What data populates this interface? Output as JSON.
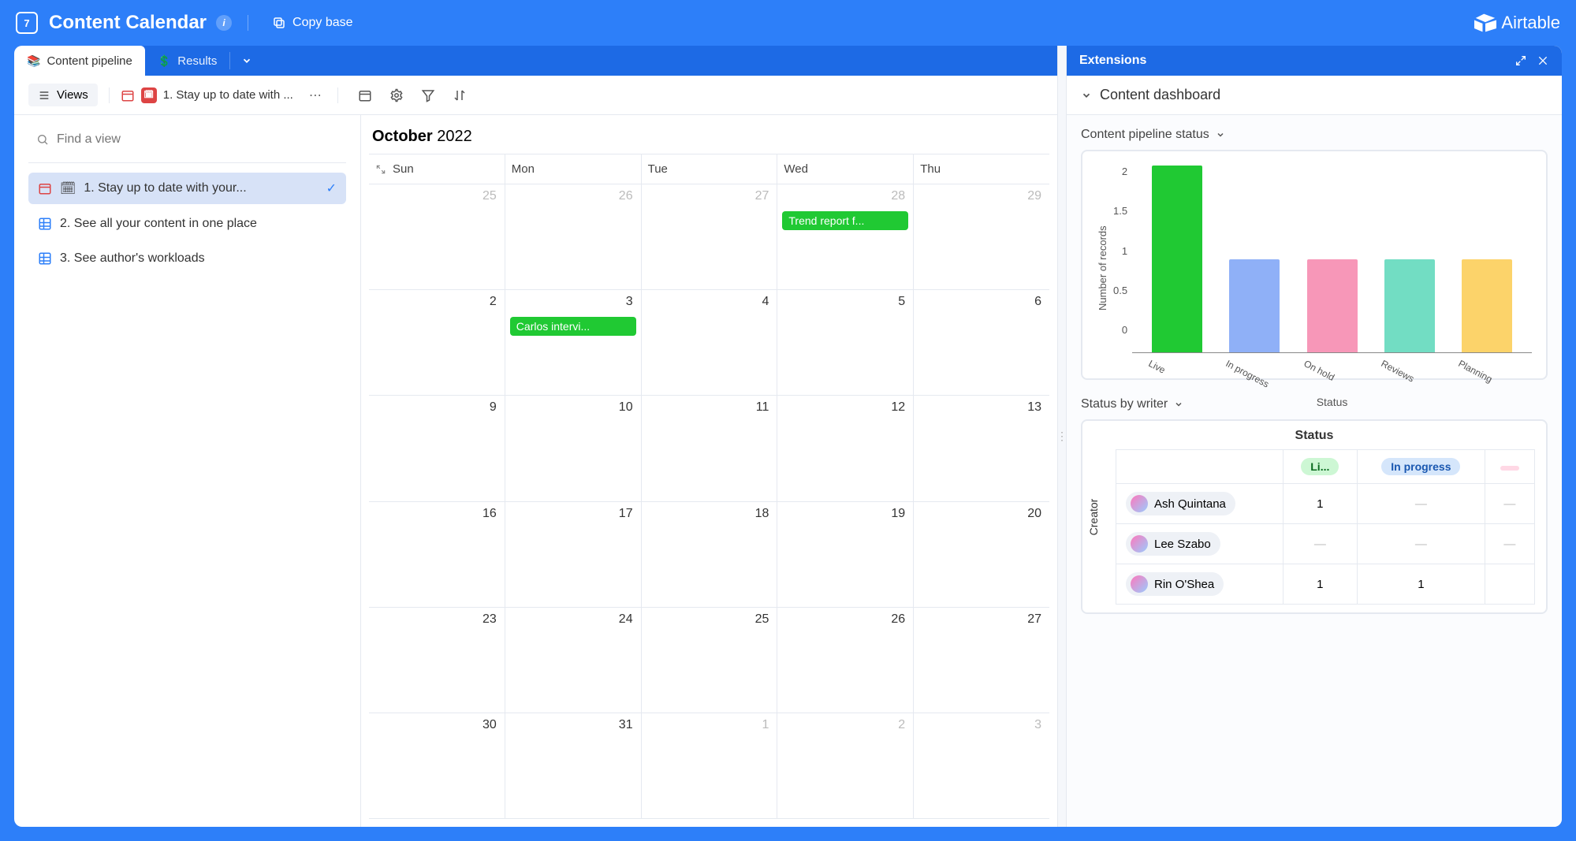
{
  "header": {
    "app_title": "Content Calendar",
    "app_day_badge": "7",
    "copy_base": "Copy base",
    "logo_text": "Airtable"
  },
  "tabs": {
    "items": [
      {
        "emoji": "📚",
        "label": "Content pipeline",
        "active": true
      },
      {
        "emoji": "💲",
        "label": "Results",
        "active": false
      }
    ]
  },
  "toolbar": {
    "views": "Views",
    "current_view_emoji": "🗓",
    "current_view": "1. Stay up to date with ..."
  },
  "sidebar": {
    "find_placeholder": "Find a view",
    "items": [
      {
        "kind": "calendar",
        "emoji": "🗓",
        "label": "1. Stay up to date with your...",
        "active": true
      },
      {
        "kind": "grid",
        "label": "2. See all your content in one place",
        "active": false
      },
      {
        "kind": "grid",
        "label": "3. See author's workloads",
        "active": false
      }
    ]
  },
  "calendar": {
    "month": "October",
    "year": "2022",
    "day_headers": [
      "Sun",
      "Mon",
      "Tue",
      "Wed",
      "Thu"
    ],
    "weeks": [
      {
        "days": [
          {
            "n": "25",
            "out": true
          },
          {
            "n": "26",
            "out": true
          },
          {
            "n": "27",
            "out": true
          },
          {
            "n": "28",
            "out": true,
            "event": "Trend report f..."
          },
          {
            "n": "29",
            "out": true
          }
        ]
      },
      {
        "days": [
          {
            "n": "2"
          },
          {
            "n": "3",
            "event": "Carlos intervi..."
          },
          {
            "n": "4"
          },
          {
            "n": "5"
          },
          {
            "n": "6"
          }
        ]
      },
      {
        "days": [
          {
            "n": "9"
          },
          {
            "n": "10"
          },
          {
            "n": "11"
          },
          {
            "n": "12"
          },
          {
            "n": "13"
          }
        ]
      },
      {
        "days": [
          {
            "n": "16"
          },
          {
            "n": "17"
          },
          {
            "n": "18"
          },
          {
            "n": "19"
          },
          {
            "n": "20"
          }
        ]
      },
      {
        "days": [
          {
            "n": "23"
          },
          {
            "n": "24"
          },
          {
            "n": "25"
          },
          {
            "n": "26"
          },
          {
            "n": "27"
          }
        ]
      },
      {
        "days": [
          {
            "n": "30"
          },
          {
            "n": "31"
          },
          {
            "n": "1",
            "out": true
          },
          {
            "n": "2",
            "out": true
          },
          {
            "n": "3",
            "out": true
          }
        ]
      }
    ]
  },
  "extensions": {
    "title": "Extensions",
    "dashboard_title": "Content dashboard",
    "widgets": {
      "pipeline_status_label": "Content pipeline status",
      "status_by_writer_label": "Status by writer"
    },
    "status_table": {
      "title": "Status",
      "row_axis": "Creator",
      "columns": [
        "Li...",
        "In progress",
        ""
      ],
      "rows": [
        {
          "name": "Ash Quintana",
          "vals": [
            "1",
            "—",
            "—"
          ]
        },
        {
          "name": "Lee Szabo",
          "vals": [
            "—",
            "—",
            "—"
          ]
        },
        {
          "name": "Rin O'Shea",
          "vals": [
            "1",
            "1",
            ""
          ]
        }
      ]
    }
  },
  "chart_data": {
    "type": "bar",
    "title": "",
    "xlabel": "Status",
    "ylabel": "Number of records",
    "ylim": [
      0,
      2
    ],
    "yticks": [
      2,
      1.5,
      1,
      0.5,
      0
    ],
    "categories": [
      "Live",
      "In progress",
      "On hold",
      "Reviews",
      "Planning"
    ],
    "values": [
      2,
      1,
      1,
      1,
      1
    ],
    "colors": [
      "#20c933",
      "#8fb0f7",
      "#f797b8",
      "#72ddc3",
      "#fcd36a"
    ]
  }
}
